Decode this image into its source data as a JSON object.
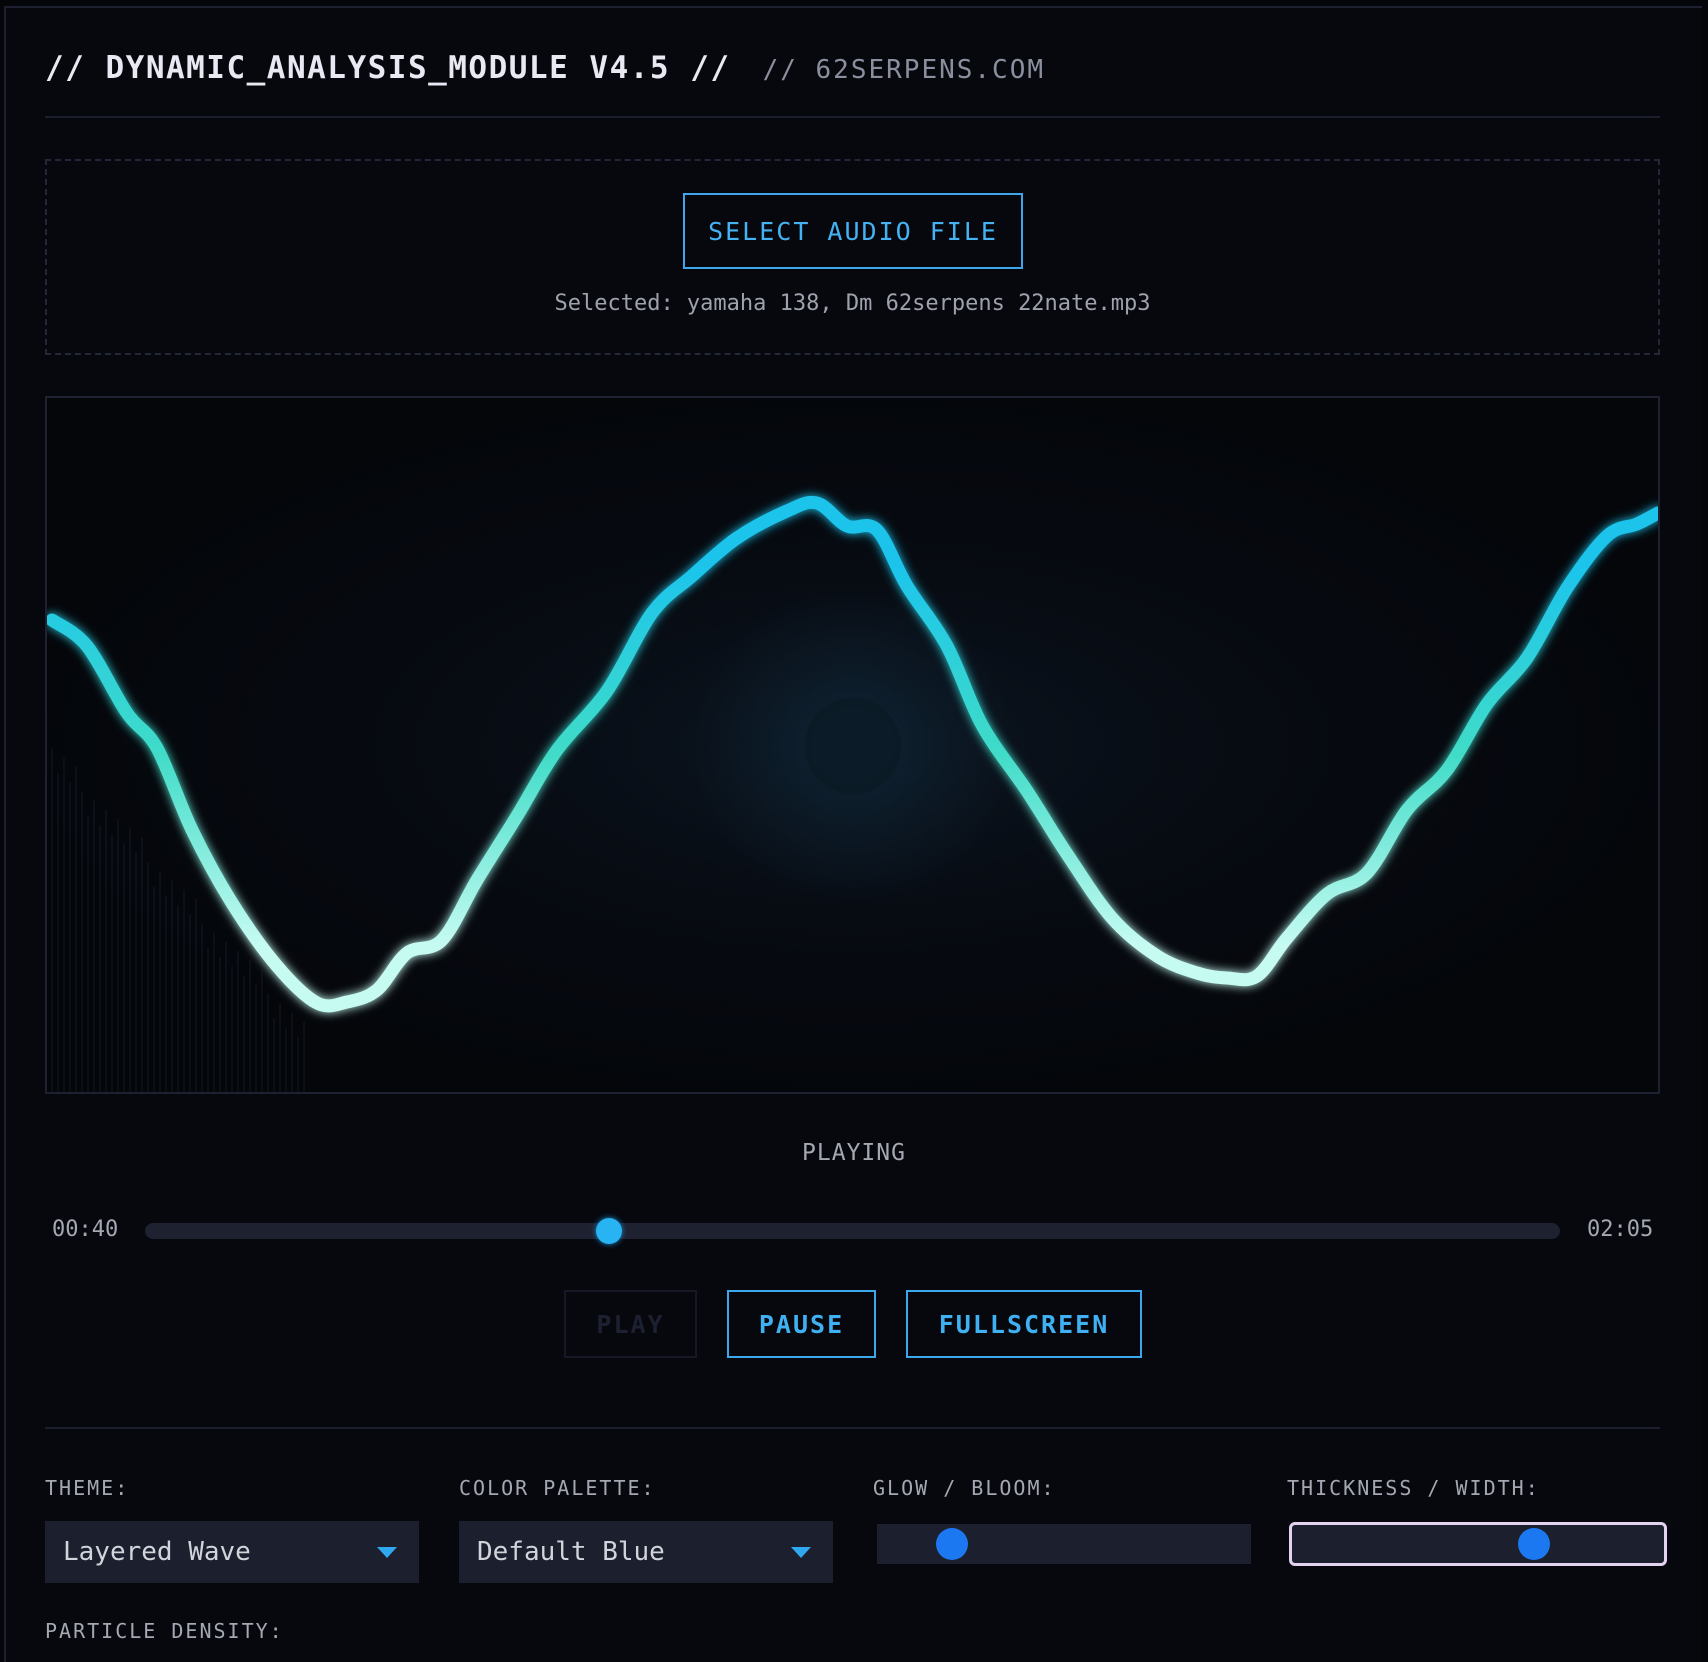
{
  "header": {
    "title": "// DYNAMIC_ANALYSIS_MODULE V4.5 //",
    "subtitle": "// 62SERPENS.COM"
  },
  "upload": {
    "button_label": "SELECT AUDIO FILE",
    "selected_text": "Selected: yamaha 138, Dm 62serpens 22nate.mp3"
  },
  "visualizer": {
    "stroke_top_color": "#1cc4ec",
    "stroke_mid_color": "#40dcc8",
    "stroke_bottom_color": "#c6fbf2"
  },
  "player": {
    "status": "PLAYING",
    "current_time": "00:40",
    "total_time": "02:05",
    "progress_fraction": 0.328,
    "play_label": "PLAY",
    "play_enabled": false,
    "pause_label": "PAUSE",
    "fullscreen_label": "FULLSCREEN"
  },
  "controls": {
    "theme": {
      "label": "THEME:",
      "value": "Layered Wave"
    },
    "palette": {
      "label": "COLOR PALETTE:",
      "value": "Default Blue"
    },
    "glow": {
      "label": "GLOW / BLOOM:",
      "value_fraction": 0.2
    },
    "thickness": {
      "label": "THICKNESS / WIDTH:",
      "value_fraction": 0.65
    },
    "particle_density": {
      "label": "PARTICLE DENSITY:"
    }
  },
  "colors": {
    "accent": "#3ea6ea",
    "slider_thumb": "#1c78f0",
    "seek_thumb": "#28b4f2"
  }
}
